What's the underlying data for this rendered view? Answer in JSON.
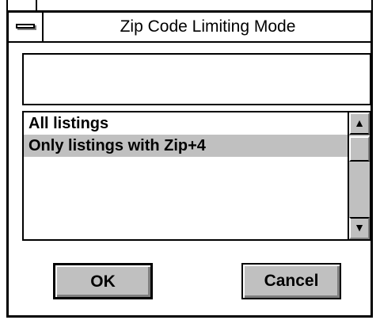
{
  "window": {
    "title": "Zip Code Limiting Mode"
  },
  "input": {
    "value": ""
  },
  "list": {
    "items": [
      {
        "label": "All listings",
        "selected": false
      },
      {
        "label": "Only listings with Zip+4",
        "selected": true
      }
    ],
    "scroll_up_glyph": "▲",
    "scroll_down_glyph": "▼"
  },
  "buttons": {
    "ok_label": "OK",
    "cancel_label": "Cancel"
  },
  "colors": {
    "selection": "#c0c0c0",
    "button_face": "#c0c0c0"
  }
}
